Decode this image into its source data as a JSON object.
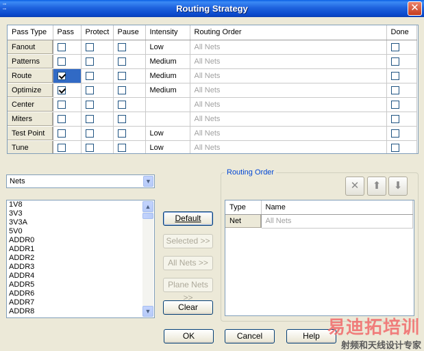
{
  "window": {
    "title": "Routing Strategy",
    "close_glyph": "✕"
  },
  "strategy_table": {
    "headers": [
      "Pass Type",
      "Pass",
      "Protect",
      "Pause",
      "Intensity",
      "Routing Order",
      "Done"
    ],
    "rows": [
      {
        "pass_type": "Fanout",
        "pass": false,
        "protect": false,
        "pause": false,
        "intensity": "Low",
        "routing_order": "All Nets",
        "done": false
      },
      {
        "pass_type": "Patterns",
        "pass": false,
        "protect": false,
        "pause": false,
        "intensity": "Medium",
        "routing_order": "All Nets",
        "done": false
      },
      {
        "pass_type": "Route",
        "pass": true,
        "protect": false,
        "pause": false,
        "intensity": "Medium",
        "routing_order": "All Nets",
        "done": false
      },
      {
        "pass_type": "Optimize",
        "pass": true,
        "protect": false,
        "pause": false,
        "intensity": "Medium",
        "routing_order": "All Nets",
        "done": false
      },
      {
        "pass_type": "Center",
        "pass": false,
        "protect": false,
        "pause": false,
        "intensity": "",
        "routing_order": "All Nets",
        "done": false
      },
      {
        "pass_type": "Miters",
        "pass": false,
        "protect": false,
        "pause": false,
        "intensity": "",
        "routing_order": "All Nets",
        "done": false
      },
      {
        "pass_type": "Test Point",
        "pass": false,
        "protect": false,
        "pause": false,
        "intensity": "Low",
        "routing_order": "All Nets",
        "done": false
      },
      {
        "pass_type": "Tune",
        "pass": false,
        "protect": false,
        "pause": false,
        "intensity": "Low",
        "routing_order": "All Nets",
        "done": false
      }
    ]
  },
  "net_filter": {
    "selected": "Nets"
  },
  "net_list": [
    "1V8",
    "3V3",
    "3V3A",
    "5V0",
    "ADDR0",
    "ADDR1",
    "ADDR2",
    "ADDR3",
    "ADDR4",
    "ADDR5",
    "ADDR6",
    "ADDR7",
    "ADDR8"
  ],
  "buttons": {
    "default": "Default",
    "selected": "Selected >>",
    "all_nets": "All Nets >>",
    "plane_nets": "Plane Nets >>",
    "clear": "Clear",
    "ok": "OK",
    "cancel": "Cancel",
    "help": "Help"
  },
  "routing_order": {
    "label": "Routing Order",
    "headers": [
      "Type",
      "Name"
    ],
    "rows": [
      {
        "type": "Net",
        "name": "All Nets"
      }
    ]
  },
  "watermark": {
    "line1": "易迪拓培训",
    "line2": "射频和天线设计专家"
  },
  "colors": {
    "title_bar": "#0a5fe4",
    "selection": "#316ac5",
    "group_label": "#0046d5"
  }
}
